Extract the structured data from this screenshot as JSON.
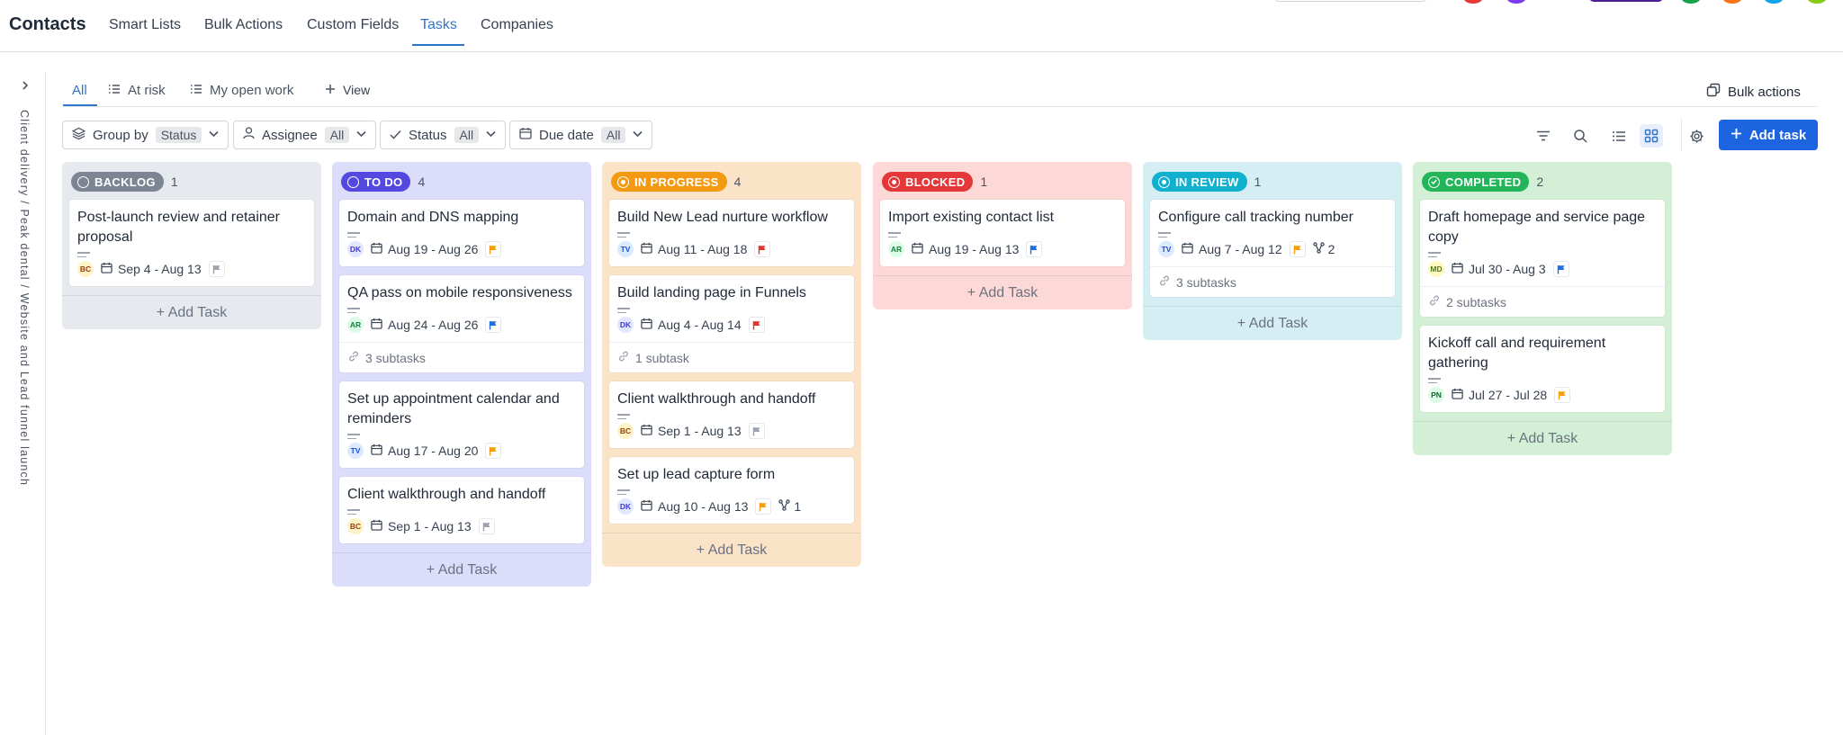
{
  "header": {
    "app_title": "Contacts",
    "nav": [
      {
        "label": "Smart Lists"
      },
      {
        "label": "Bulk Actions"
      },
      {
        "label": "Custom Fields"
      },
      {
        "label": "Tasks",
        "active": true
      },
      {
        "label": "Companies"
      }
    ]
  },
  "sidebar": {
    "breadcrumb": "Client delivery / Peak dental / Website and Lead funnel launch"
  },
  "views": {
    "tabs": [
      {
        "label": "All",
        "active": true,
        "icon": ""
      },
      {
        "label": "At risk",
        "icon": "list-icon"
      },
      {
        "label": "My open work",
        "icon": "list-icon"
      },
      {
        "label": "View",
        "icon": "plus-icon"
      }
    ],
    "bulk_actions_label": "Bulk actions"
  },
  "filters": {
    "group_by": {
      "label": "Group by",
      "value": "Status"
    },
    "assignee": {
      "label": "Assignee",
      "value": "All"
    },
    "status": {
      "label": "Status",
      "value": "All"
    },
    "due_date": {
      "label": "Due date",
      "value": "All"
    }
  },
  "toolbar": {
    "add_task_label": "Add task",
    "active_view": "board"
  },
  "colors": {
    "accent": "#1d64e0",
    "flag_orange": "#f59e0b",
    "flag_blue": "#1d6fe0",
    "flag_red": "#e5322d",
    "flag_gray": "#9ca3af"
  },
  "board": {
    "add_task_label": "+ Add Task",
    "columns": [
      {
        "status": "BACKLOG",
        "count": "1",
        "bg": "#e6e9ee",
        "pill": "#7d8594",
        "cards": [
          {
            "title": "Post-launch review and retainer proposal",
            "avatar": "BC",
            "dates": "Sep 4 - Aug 13",
            "flag": "gray"
          }
        ]
      },
      {
        "status": "TO DO",
        "count": "4",
        "bg": "#dcdcfb",
        "pill": "#5548e0",
        "cards": [
          {
            "title": "Domain and DNS mapping",
            "avatar": "DK",
            "dates": "Aug 19 - Aug 26",
            "flag": "orange"
          },
          {
            "title": "QA pass on mobile responsiveness",
            "avatar": "AR",
            "dates": "Aug 24 - Aug 26",
            "flag": "blue",
            "subtasks": "3 subtasks"
          },
          {
            "title": "Set up appointment calendar and reminders",
            "avatar": "TV",
            "dates": "Aug 17 - Aug 20",
            "flag": "orange"
          },
          {
            "title": "Client walkthrough and handoff",
            "avatar": "BC",
            "dates": "Sep 1 - Aug 13",
            "flag": "gray"
          }
        ]
      },
      {
        "status": "IN PROGRESS",
        "count": "4",
        "bg": "#fbe3c8",
        "pill": "#f39a12",
        "cards": [
          {
            "title": "Build New Lead nurture workflow",
            "avatar": "TV",
            "dates": "Aug 11 - Aug 18",
            "flag": "red"
          },
          {
            "title": "Build landing page in Funnels",
            "avatar": "DK",
            "dates": "Aug 4 - Aug 14",
            "flag": "red",
            "subtasks": "1 subtask"
          },
          {
            "title": "Client walkthrough and handoff",
            "avatar": "BC",
            "dates": "Sep 1 - Aug 13",
            "flag": "gray"
          },
          {
            "title": "Set up lead capture form",
            "avatar": "DK",
            "dates": "Aug 10 - Aug 13",
            "flag": "orange",
            "extra": "1"
          }
        ]
      },
      {
        "status": "BLOCKED",
        "count": "1",
        "bg": "#fcd9d7",
        "pill": "#e3373a",
        "cards": [
          {
            "title": "Import existing contact list",
            "avatar": "AR",
            "dates": "Aug 19 - Aug 13",
            "flag": "blue"
          }
        ]
      },
      {
        "status": "IN REVIEW",
        "count": "1",
        "bg": "#d5eef3",
        "pill": "#12b0cf",
        "cards": [
          {
            "title": "Configure call tracking number",
            "avatar": "TV",
            "dates": "Aug 7 - Aug 12",
            "flag": "orange",
            "extra": "2",
            "subtasks": "3 subtasks"
          }
        ]
      },
      {
        "status": "COMPLETED",
        "count": "2",
        "bg": "#d3f0d6",
        "pill": "#22b55a",
        "cards": [
          {
            "title": "Draft homepage and service page copy",
            "avatar": "MD",
            "dates": "Jul 30 - Aug 3",
            "flag": "blue",
            "subtasks": "2 subtasks"
          },
          {
            "title": "Kickoff call and requirement gathering",
            "avatar": "PN",
            "dates": "Jul 27 - Jul 28",
            "flag": "orange"
          }
        ]
      }
    ]
  }
}
